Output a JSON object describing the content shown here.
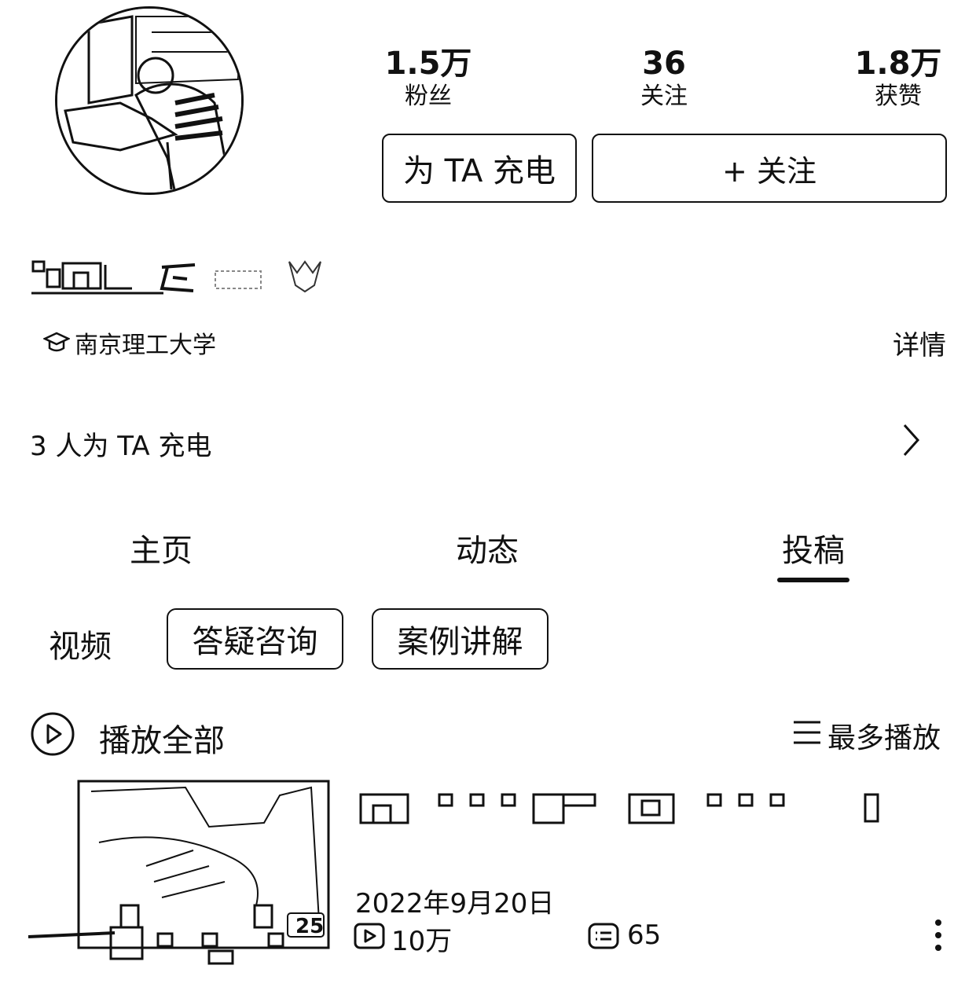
{
  "profile": {
    "avatar_icon": "user-avatar-photo",
    "stats": [
      {
        "value": "1.5万",
        "label": "粉丝"
      },
      {
        "value": "36",
        "label": "关注"
      },
      {
        "value": "1.8万",
        "label": "获赞"
      }
    ],
    "charge_button": "为 TA 充电",
    "follow_button": "+ 关注",
    "school": "南京理工大学",
    "detail_link": "详情",
    "charge_count_text": "3 人为 TA 充电"
  },
  "tabs": [
    {
      "label": "主页",
      "active": false
    },
    {
      "label": "动态",
      "active": false
    },
    {
      "label": "投稿",
      "active": true
    }
  ],
  "filters": {
    "category": "视频",
    "chips": [
      "答疑咨询",
      "案例讲解"
    ]
  },
  "playlist": {
    "play_all": "播放全部",
    "sort_label": "最多播放"
  },
  "video": {
    "date": "2022年9月20日",
    "views": "10万",
    "comments": "65",
    "duration_partial": "25"
  },
  "colors": {
    "foreground": "#111111",
    "background": "#ffffff"
  }
}
